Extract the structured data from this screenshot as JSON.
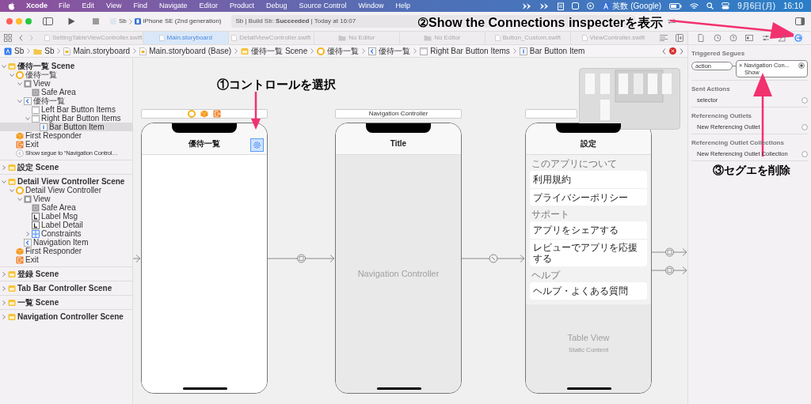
{
  "menu_bar": {
    "app": "Xcode",
    "items": [
      "File",
      "Edit",
      "View",
      "Find",
      "Navigate",
      "Editor",
      "Product",
      "Debug",
      "Source Control",
      "Window",
      "Help"
    ],
    "input_source": "英数 (Google)",
    "date": "9月6日(月)",
    "time": "16:10"
  },
  "toolbar": {
    "scheme": "Sb",
    "device": "iPhone SE (2nd generation)",
    "status": "Sb | Build Sb: **Succeeded** | Today at 16:07"
  },
  "tabs": [
    {
      "label": "SettingTableViewController.swift",
      "kind": "file",
      "selected": false
    },
    {
      "label": "Main.storyboard",
      "kind": "file",
      "selected": true
    },
    {
      "label": "DetailViewController.swift",
      "kind": "file",
      "selected": false
    },
    {
      "label": "No Editor",
      "kind": "empty",
      "selected": false
    },
    {
      "label": "No Editor",
      "kind": "empty",
      "selected": false
    },
    {
      "label": "Button_Custom.swift",
      "kind": "file",
      "selected": false
    },
    {
      "label": "ViewController.swift",
      "kind": "file",
      "selected": false
    }
  ],
  "jump_bar": [
    {
      "label": "Sb",
      "kind": "project"
    },
    {
      "label": "Sb",
      "kind": "folder"
    },
    {
      "label": "Main.storyboard",
      "kind": "storyboard"
    },
    {
      "label": "Main.storyboard (Base)",
      "kind": "storyboard"
    },
    {
      "label": "優待一覧 Scene",
      "kind": "scene"
    },
    {
      "label": "優待一覧",
      "kind": "controller"
    },
    {
      "label": "優待一覧",
      "kind": "nav_item"
    },
    {
      "label": "Right Bar Button Items",
      "kind": "bar_items"
    },
    {
      "label": "Bar Button Item",
      "kind": "bar_item"
    }
  ],
  "outline": [
    {
      "label": "優待一覧 Scene",
      "kind": "scene",
      "expanded": true,
      "selected": false,
      "children": [
        {
          "label": "優待一覧",
          "kind": "controller",
          "expanded": true,
          "selected": false,
          "children": [
            {
              "label": "View",
              "kind": "view",
              "expanded": true,
              "selected": false,
              "children": [
                {
                  "label": "Safe Area",
                  "kind": "safe_area",
                  "selected": false
                }
              ]
            },
            {
              "label": "優待一覧",
              "kind": "nav_item",
              "expanded": true,
              "selected": false,
              "children": [
                {
                  "label": "Left Bar Button Items",
                  "kind": "bar_items",
                  "selected": false
                },
                {
                  "label": "Right Bar Button Items",
                  "kind": "bar_items",
                  "expanded": true,
                  "selected": false,
                  "children": [
                    {
                      "label": "Bar Button Item",
                      "kind": "bar_item",
                      "selected": true
                    }
                  ]
                }
              ]
            }
          ]
        },
        {
          "label": "First Responder",
          "kind": "responder",
          "selected": false
        },
        {
          "label": "Exit",
          "kind": "exit",
          "selected": false
        },
        {
          "label": "Show segue to “Navigation Control…",
          "kind": "segue",
          "selected": false
        }
      ]
    },
    {
      "label": "設定 Scene",
      "kind": "scene",
      "expanded": false,
      "selected": false
    },
    {
      "label": "Detail View Controller Scene",
      "kind": "scene",
      "expanded": true,
      "selected": false,
      "children": [
        {
          "label": "Detail View Controller",
          "kind": "controller",
          "expanded": true,
          "selected": false,
          "children": [
            {
              "label": "View",
              "kind": "view",
              "expanded": true,
              "selected": false,
              "children": [
                {
                  "label": "Safe Area",
                  "kind": "safe_area",
                  "selected": false
                },
                {
                  "label": "Label Msg",
                  "kind": "label",
                  "selected": false
                },
                {
                  "label": "Label Detail",
                  "kind": "label",
                  "selected": false
                },
                {
                  "label": "Constraints",
                  "kind": "constraints",
                  "expanded": false,
                  "selected": false
                }
              ]
            },
            {
              "label": "Navigation Item",
              "kind": "nav_item",
              "selected": false
            }
          ]
        },
        {
          "label": "First Responder",
          "kind": "responder",
          "selected": false
        },
        {
          "label": "Exit",
          "kind": "exit",
          "selected": false
        }
      ]
    },
    {
      "label": "登録 Scene",
      "kind": "scene",
      "expanded": false,
      "selected": false
    },
    {
      "label": "Tab Bar Controller Scene",
      "kind": "scene",
      "expanded": false,
      "selected": false
    },
    {
      "label": "一覧 Scene",
      "kind": "scene",
      "expanded": false,
      "selected": false
    },
    {
      "label": "Navigation Controller Scene",
      "kind": "scene",
      "expanded": false,
      "selected": false
    }
  ],
  "canvas": {
    "scenes": [
      {
        "kind": "list",
        "dock_icons": [
          {
            "kind": "controller"
          },
          {
            "kind": "responder"
          },
          {
            "kind": "exit"
          }
        ],
        "nav_title": "優待一覧",
        "bar_button_selected": true
      },
      {
        "kind": "navigation",
        "dock_title": "Navigation Controller",
        "nav_title": "Title",
        "placeholder": "Navigation Controller"
      },
      {
        "kind": "table",
        "nav_title": "設定",
        "sections": [
          {
            "header": "このアプリについて",
            "rows": [
              "利用規約",
              "プライバシーポリシー"
            ]
          },
          {
            "header": "サポート",
            "rows": [
              "アプリをシェアする",
              "レビューでアプリを応援する"
            ]
          },
          {
            "header": "ヘルプ",
            "rows": [
              "ヘルプ・よくある質問"
            ]
          }
        ],
        "placeholder": "Table View",
        "subtitle": "Static Content"
      }
    ]
  },
  "inspector": {
    "tabs": [
      {
        "kind": "file",
        "selected": false
      },
      {
        "kind": "history",
        "selected": false
      },
      {
        "kind": "help",
        "selected": false
      },
      {
        "kind": "identity",
        "selected": false
      },
      {
        "kind": "attributes",
        "selected": false
      },
      {
        "kind": "size",
        "selected": false
      },
      {
        "kind": "connections",
        "selected": true
      }
    ],
    "sections": [
      {
        "title": "Triggered Segues",
        "rows": [
          {
            "kind": "segue",
            "name": "action",
            "remove": "×",
            "target": "Navigation Con...",
            "detail": "Show"
          }
        ]
      },
      {
        "title": "Sent Actions",
        "rows": [
          {
            "kind": "outlet",
            "name": "selector"
          }
        ]
      },
      {
        "title": "Referencing Outlets",
        "rows": [
          {
            "kind": "outlet",
            "name": "New Referencing Outlet"
          }
        ]
      },
      {
        "title": "Referencing Outlet Collections",
        "rows": [
          {
            "kind": "outlet",
            "name": "New Referencing Outlet Collection"
          }
        ]
      }
    ]
  },
  "annotations": [
    {
      "text": "①コントロールを選択"
    },
    {
      "text": "②Show the Connections inspecterを表示"
    },
    {
      "text": "③セグエを削除"
    }
  ]
}
